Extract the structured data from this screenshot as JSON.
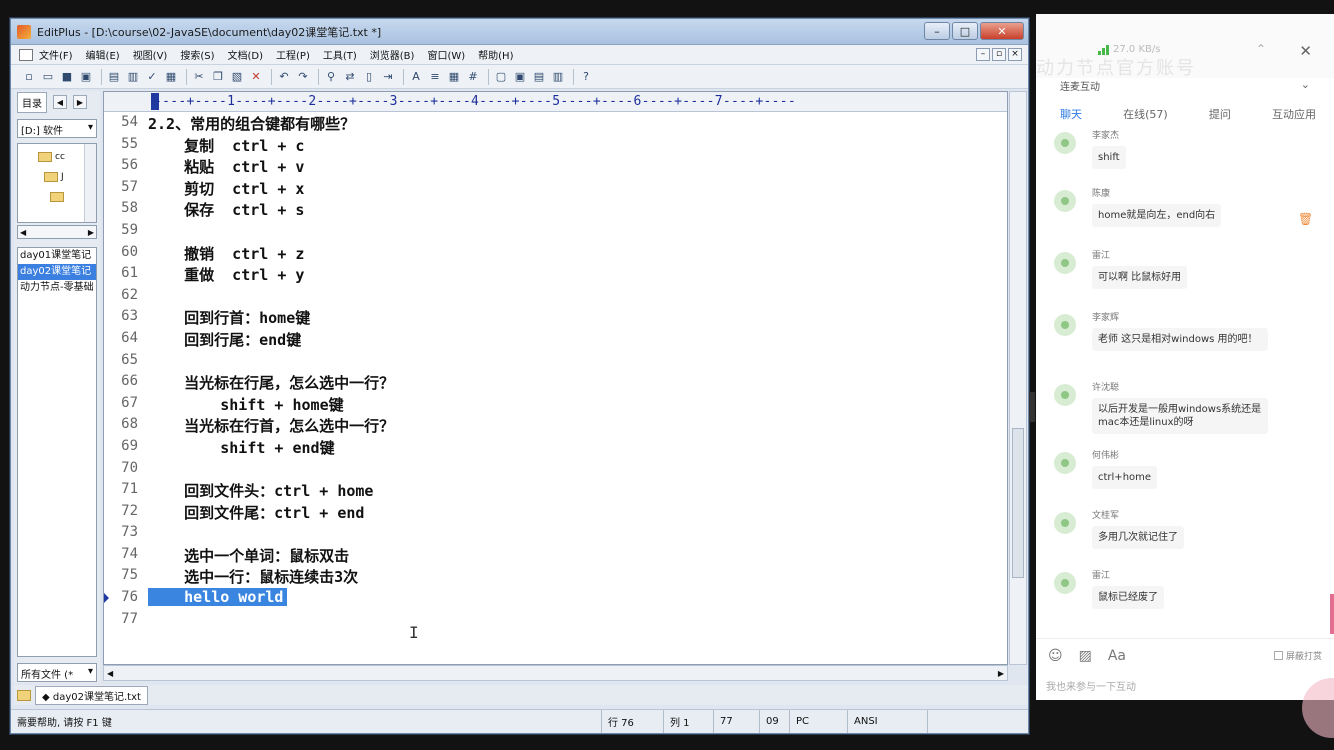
{
  "window": {
    "title": "EditPlus - [D:\\course\\02-JavaSE\\document\\day02课堂笔记.txt *]",
    "controls": [
      "–",
      "□",
      "✕"
    ]
  },
  "menu": [
    "文件(F)",
    "编辑(E)",
    "视图(V)",
    "搜索(S)",
    "文档(D)",
    "工程(P)",
    "工具(T)",
    "浏览器(B)",
    "窗口(W)",
    "帮助(H)"
  ],
  "dirpane": {
    "tab": "目录",
    "drive": "[D:] 软件",
    "tree": [
      "cc",
      "J",
      ""
    ],
    "files": [
      "day01课堂笔记",
      "day02课堂笔记",
      "动力节点-零基础"
    ],
    "selected_file": 1,
    "filter": "所有文件 (*"
  },
  "editor": {
    "ruler": "----+----1----+----2----+----3----+----4----+----5----+----6----+----7----+----",
    "lines": [
      {
        "n": "54",
        "text": "2.2、常用的组合键都有哪些？"
      },
      {
        "n": "55",
        "text": "    复制  ctrl + c"
      },
      {
        "n": "56",
        "text": "    粘贴  ctrl + v"
      },
      {
        "n": "57",
        "text": "    剪切  ctrl + x"
      },
      {
        "n": "58",
        "text": "    保存  ctrl + s"
      },
      {
        "n": "59",
        "text": ""
      },
      {
        "n": "60",
        "text": "    撤销  ctrl + z"
      },
      {
        "n": "61",
        "text": "    重做  ctrl + y"
      },
      {
        "n": "62",
        "text": ""
      },
      {
        "n": "63",
        "text": "    回到行首：home键"
      },
      {
        "n": "64",
        "text": "    回到行尾：end键"
      },
      {
        "n": "65",
        "text": ""
      },
      {
        "n": "66",
        "text": "    当光标在行尾，怎么选中一行？"
      },
      {
        "n": "67",
        "text": "        shift + home键"
      },
      {
        "n": "68",
        "text": "    当光标在行首，怎么选中一行？"
      },
      {
        "n": "69",
        "text": "        shift + end键"
      },
      {
        "n": "70",
        "text": ""
      },
      {
        "n": "71",
        "text": "    回到文件头：ctrl + home"
      },
      {
        "n": "72",
        "text": "    回到文件尾：ctrl + end"
      },
      {
        "n": "73",
        "text": ""
      },
      {
        "n": "74",
        "text": "    选中一个单词：鼠标双击"
      },
      {
        "n": "75",
        "text": "    选中一行：鼠标连续击3次"
      },
      {
        "n": "76",
        "text": "    hello world"
      },
      {
        "n": "77",
        "text": ""
      }
    ],
    "highlight_line": "76"
  },
  "doc_tab": "◆ day02课堂笔记.txt",
  "statusbar": {
    "help": "需要帮助, 请按 F1 键",
    "row": "行 76",
    "col": "列 1",
    "num77": "77",
    "num09": "09",
    "pc": "PC",
    "enc": "ANSI"
  },
  "chat": {
    "watermark": "动力节点官方账号",
    "speed": "27.0 KB/s",
    "header": "连麦互动",
    "tabs": [
      "聊天",
      "在线(57)",
      "提问",
      "互动应用"
    ],
    "messages": [
      {
        "name": "李家杰",
        "text": "shift"
      },
      {
        "name": "陈康",
        "text": "home就是向左，end向右"
      },
      {
        "name": "雷江",
        "text": "可以啊 比鼠标好用"
      },
      {
        "name": "李家辉",
        "text": "老师 这只是相对windows 用的吧！"
      },
      {
        "name": "许沈聪",
        "text": "以后开发是一般用windows系统还是mac本还是linux的呀"
      },
      {
        "name": "何伟彬",
        "text": "ctrl+home"
      },
      {
        "name": "文桂军",
        "text": "多用几次就记住了"
      },
      {
        "name": "雷江",
        "text": "鼠标已经废了"
      }
    ],
    "shield_label": "屏蔽打赏",
    "input_placeholder": "我也来参与一下互动",
    "accent": "#2d7be5"
  }
}
